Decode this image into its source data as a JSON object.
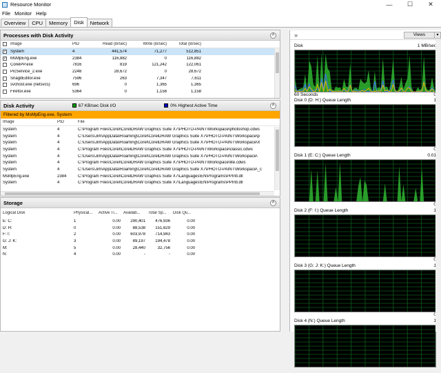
{
  "window": {
    "title": "Resource Monitor",
    "minimize": "—",
    "maximize": "☐",
    "close": "✕"
  },
  "menu": [
    "File",
    "Monitor",
    "Help"
  ],
  "tabs": [
    "Overview",
    "CPU",
    "Memory",
    "Disk",
    "Network"
  ],
  "processes": {
    "title": "Processes with Disk Activity",
    "columns": [
      "Image",
      "PID",
      "Read (B/sec)",
      "Write (B/sec)",
      "Total (B/sec)"
    ],
    "rows": [
      {
        "image": "System",
        "pid": "4",
        "read": "441,574",
        "write": "71,277",
        "total": "512,851",
        "checked": true,
        "selected": true
      },
      {
        "image": "MsMpEng.exe",
        "pid": "2384",
        "read": "116,882",
        "write": "0",
        "total": "116,882",
        "checked": true,
        "selected": false
      },
      {
        "image": "CorelPP.exe",
        "pid": "7816",
        "read": "819",
        "write": "121,242",
        "total": "122,061",
        "checked": false,
        "selected": false
      },
      {
        "image": "PicService_2.exe",
        "pid": "2248",
        "read": "28,672",
        "write": "0",
        "total": "28,672",
        "checked": false,
        "selected": false
      },
      {
        "image": "SnagitEditor.exe",
        "pid": "7596",
        "read": "263",
        "write": "7,347",
        "total": "7,611",
        "checked": false,
        "selected": false
      },
      {
        "image": "svchost.exe (netsvcs)",
        "pid": "696",
        "read": "0",
        "write": "1,365",
        "total": "1,365",
        "checked": false,
        "selected": false
      },
      {
        "image": "Firefox.exe",
        "pid": "5364",
        "read": "0",
        "write": "1,158",
        "total": "1,158",
        "checked": false,
        "selected": false
      }
    ]
  },
  "diskActivity": {
    "title": "Disk Activity",
    "legend1": "67 KB/sec Disk I/O",
    "legend2": "0% Highest Active Time",
    "legend1_color": "#00a000",
    "legend2_color": "#0000c0",
    "filter": "Filtered by MsMpEng.exe, System",
    "columns": [
      "Image",
      "PID",
      "File"
    ],
    "rows": [
      {
        "image": "System",
        "pid": "4",
        "file": "C:\\Program Files\\Corel\\CorelDRAW Graphics Suite X7\\PHOTO-PAINT\\Workspace\\photoshop.cdws"
      },
      {
        "image": "System",
        "pid": "4",
        "file": "C:\\Users\\Jim\\AppData\\Roaming\\Corel\\CorelDRAW Graphics Suite X7\\PHOTO-PAINT\\Workspace\\p"
      },
      {
        "image": "System",
        "pid": "4",
        "file": "C:\\Users\\Jim\\AppData\\Roaming\\Corel\\CorelDRAW Graphics Suite X7\\PHOTO-PAINT\\Workspace\\X"
      },
      {
        "image": "System",
        "pid": "4",
        "file": "C:\\Program Files\\Corel\\CorelDRAW Graphics Suite X7\\PHOTO-PAINT\\Workspace\\classic.cdws"
      },
      {
        "image": "System",
        "pid": "4",
        "file": "C:\\Users\\Jim\\AppData\\Roaming\\Corel\\CorelDRAW Graphics Suite X7\\PHOTO-PAINT\\Workspace\\"
      },
      {
        "image": "System",
        "pid": "4",
        "file": "C:\\Program Files\\Corel\\CorelDRAW Graphics Suite X7\\PHOTO-PAINT\\Workspace\\lite.cdws"
      },
      {
        "image": "System",
        "pid": "4",
        "file": "C:\\Users\\Jim\\AppData\\Roaming\\Corel\\CorelDRAW Graphics Suite X7\\PHOTO-PAINT\\Workspace\\_c"
      },
      {
        "image": "MsMpEng.exe",
        "pid": "2384",
        "file": "C:\\Program Files\\Corel\\CorelDRAW Graphics Suite X7\\Languages\\EN\\Programs\\PPIntl.dll"
      },
      {
        "image": "System",
        "pid": "4",
        "file": "C:\\Program Files\\Corel\\CorelDRAW Graphics Suite X7\\Languages\\EN\\Programs\\PPIntl.dll"
      }
    ]
  },
  "storage": {
    "title": "Storage",
    "columns": [
      "Logical Disk",
      "Physical...",
      "Active Ti...",
      "Availab...",
      "Total Sp...",
      "Disk Qu..."
    ],
    "rows": [
      {
        "disk": "E: C:",
        "phys": "1",
        "active": "0.00",
        "avail": "290,401",
        "total": "476,936",
        "queue": "0.00"
      },
      {
        "disk": "D: H:",
        "phys": "0",
        "active": "0.00",
        "avail": "88,538",
        "total": "151,629",
        "queue": "0.00"
      },
      {
        "disk": "F: I:",
        "phys": "2",
        "active": "0.00",
        "avail": "603,978",
        "total": "714,943",
        "queue": "0.00"
      },
      {
        "disk": "G: J: K:",
        "phys": "3",
        "active": "0.00",
        "avail": "89,197",
        "total": "194,478",
        "queue": "0.00"
      },
      {
        "disk": "M:",
        "phys": "5",
        "active": "0.00",
        "avail": "28,440",
        "total": "32,756",
        "queue": "0.00"
      },
      {
        "disk": "N:",
        "phys": "4",
        "active": "0.00",
        "avail": "-",
        "total": "-",
        "queue": "0.00"
      }
    ]
  },
  "graphs": {
    "views_label": "Views",
    "expand_glyph": "»",
    "panels": [
      {
        "title": "Disk",
        "top_value": "1 MB/sec",
        "bottom_left": "60 Seconds",
        "bottom_right": "0",
        "activity": "high"
      },
      {
        "title": "Disk 0 (D: H:) Queue Length",
        "top_value": "1",
        "bottom_left": "",
        "bottom_right": "0",
        "activity": "none"
      },
      {
        "title": "Disk 1 (E: C:) Queue Length",
        "top_value": "0.01",
        "bottom_left": "",
        "bottom_right": "0",
        "activity": "medium"
      },
      {
        "title": "Disk 2 (F: I:) Queue Length",
        "top_value": "1",
        "bottom_left": "",
        "bottom_right": "0",
        "activity": "none"
      },
      {
        "title": "Disk 3 (G: J: K:) Queue Length",
        "top_value": "1",
        "bottom_left": "",
        "bottom_right": "0",
        "activity": "none"
      },
      {
        "title": "Disk 4 (N:) Queue Length",
        "top_value": "1",
        "bottom_left": "",
        "bottom_right": "",
        "activity": "none"
      }
    ]
  }
}
